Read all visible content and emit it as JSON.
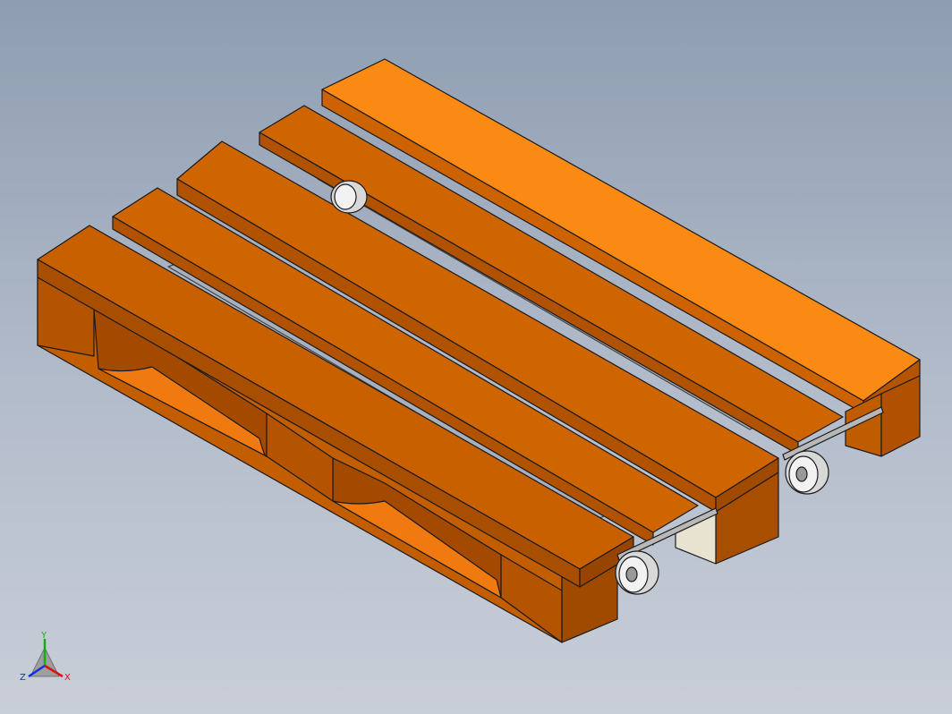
{
  "viewport": {
    "background_top": "#8e9db1",
    "background_bottom": "#c9ced8"
  },
  "model": {
    "wood_top_color": "#f07a10",
    "wood_front_color": "#c86000",
    "wood_side_color": "#b55400",
    "wood_dark_color": "#8a3f00",
    "edge_color": "#1a1a1a",
    "metal_color": "#b8b8b8",
    "wheel_color": "#e6e6e6"
  },
  "triad": {
    "x_label": "X",
    "y_label": "Y",
    "z_label": "Z",
    "x_color": "#e01010",
    "y_color": "#10b010",
    "z_color": "#1030e0"
  }
}
